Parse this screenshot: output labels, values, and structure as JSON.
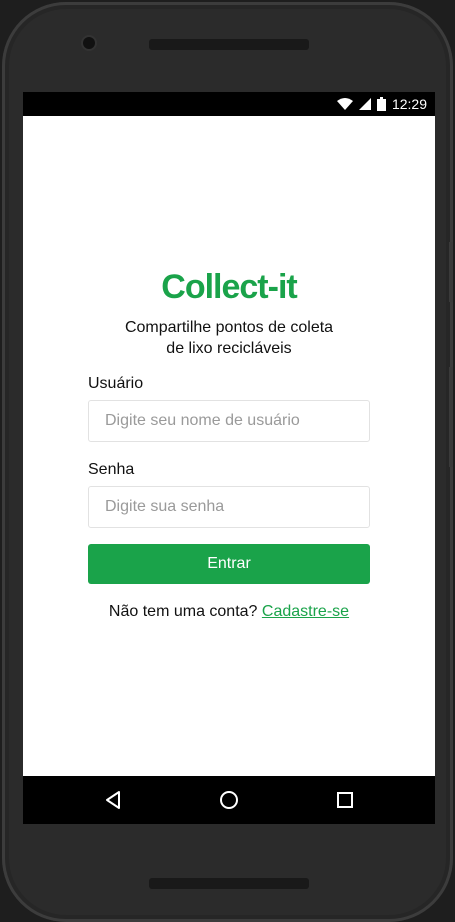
{
  "status_bar": {
    "time": "12:29",
    "icons": [
      "wifi-icon",
      "signal-icon",
      "battery-icon"
    ]
  },
  "app": {
    "title": "Collect-it",
    "tagline_line1": "Compartilhe pontos de coleta",
    "tagline_line2": "de lixo recicláveis"
  },
  "login_form": {
    "username_label": "Usuário",
    "username_placeholder": "Digite seu nome de usuário",
    "username_value": "",
    "password_label": "Senha",
    "password_placeholder": "Digite sua senha",
    "password_value": "",
    "submit_label": "Entrar"
  },
  "signup": {
    "prompt": "Não tem uma conta?",
    "link_label": "Cadastre-se"
  },
  "nav_bar": {
    "buttons": [
      "back-icon",
      "home-icon",
      "recents-icon"
    ]
  },
  "colors": {
    "brand_green": "#1aa34a",
    "status_bar": "#000000",
    "nav_bar": "#000000",
    "screen_background": "#ffffff"
  }
}
